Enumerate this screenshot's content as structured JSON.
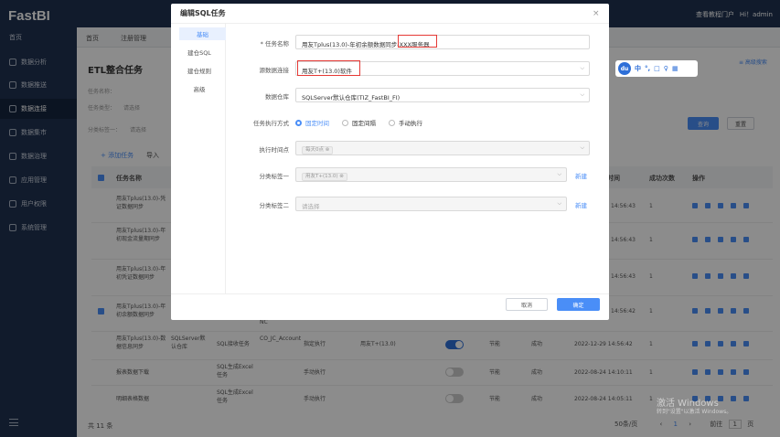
{
  "app": {
    "name": "FastBI",
    "tutorial_link": "查看教程门户",
    "user": "Hi！admin"
  },
  "sidebar": {
    "items": [
      {
        "label": "首页"
      },
      {
        "label": "数据分析"
      },
      {
        "label": "数据推送"
      },
      {
        "label": "数据连接"
      },
      {
        "label": "数据集市"
      },
      {
        "label": "数据治理"
      },
      {
        "label": "应用管理"
      },
      {
        "label": "用户权限"
      },
      {
        "label": "系统管理"
      }
    ]
  },
  "tabs": [
    {
      "label": "首页"
    },
    {
      "label": "注册管理"
    }
  ],
  "page": {
    "title": "ETL整合任务",
    "advanced_search": "≡ 高级搜索",
    "filters": {
      "name_label": "任务名称：",
      "type_label": "任务类型：",
      "type_value": "请选择",
      "tag_label": "分类标签一：",
      "tag_value": "请选择"
    },
    "query_button": "查询",
    "reset_button": "重置",
    "add_task": "+ 添加任务",
    "import_button": "导入",
    "table": {
      "headers": {
        "name": "任务名称",
        "time": "时间",
        "success": "成功次数",
        "actions": "操作"
      },
      "rows": [
        {
          "name": "用友Tplus(13.0)-凭证数据同步",
          "time": "14:56:43",
          "success": "1"
        },
        {
          "name": "用友Tplus(13.0)-年初现金流量期同步",
          "time": "14:56:43",
          "success": "1"
        },
        {
          "name": "用友Tplus(13.0)-年初凭证数据同步",
          "time": "14:56:43",
          "success": "1"
        },
        {
          "name": "用友Tplus(13.0)-年初余额数据同步",
          "time": "14:56:42",
          "success": "1"
        },
        {
          "name": "用友Tplus(13.0)-数据信息同步",
          "source": "SQLServer默认仓库",
          "type": "SQL接收任务",
          "dest": "CO_JC_Account",
          "mode": "指定执行",
          "conn": "用友T+(13.0)",
          "level": "节能",
          "status": "成功",
          "time": "2022-12-29 14:56:42",
          "success": "1"
        },
        {
          "name": "报表数据下载",
          "type": "SQL生成Excel任务",
          "mode": "手动执行",
          "level": "节能",
          "status": "成功",
          "time": "2022-08-24 14:10:11",
          "success": "1"
        },
        {
          "name": "明细表格数据",
          "type": "SQL生成Excel任务",
          "mode": "手动执行",
          "level": "节能",
          "status": "成功",
          "time": "2022-08-24 14:05:11",
          "success": "1"
        }
      ],
      "extra_cell": "NC"
    },
    "total": "共 11 条",
    "page_size": "50条/页",
    "current_page": "1",
    "goto": "前往",
    "page_unit": "页"
  },
  "modal": {
    "title": "编辑SQL任务",
    "close": "×",
    "nav": [
      {
        "label": "基础"
      },
      {
        "label": "建仓SQL"
      },
      {
        "label": "建仓规则"
      },
      {
        "label": "高级"
      }
    ],
    "fields": {
      "task_name_label": "* 任务名称",
      "task_name_value": "用友Tplus(13.0)-年初余额数据同步-XXX服务器",
      "source_label": "源数据连接",
      "source_value": "用友T+(13.0)软件",
      "warehouse_label": "数据仓库",
      "warehouse_value": "SQLServer默认仓库(TIZ_FastBI_FI)",
      "exec_label": "任务执行方式",
      "exec_options": [
        {
          "label": "固定时间"
        },
        {
          "label": "固定间隔"
        },
        {
          "label": "手动执行"
        }
      ],
      "time_label": "执行时间点",
      "time_chip": "每天0点",
      "tag1_label": "分类标签一",
      "tag1_chip": "用友T+(13.0)",
      "tag2_label": "分类标签二",
      "tag2_placeholder": "请选择",
      "new_link": "新建"
    },
    "cancel": "取消",
    "confirm": "确定"
  },
  "floating_toolbar": {
    "logo": "du",
    "items": [
      "中",
      "°,",
      "□",
      "♀",
      "▦"
    ]
  },
  "watermark": {
    "line1": "激活 Windows",
    "line2": "转到\"设置\"以激活 Windows。"
  },
  "colors": {
    "primary": "#4a8ef7",
    "sidebar": "#1f3251",
    "highlight": "#e53935"
  }
}
